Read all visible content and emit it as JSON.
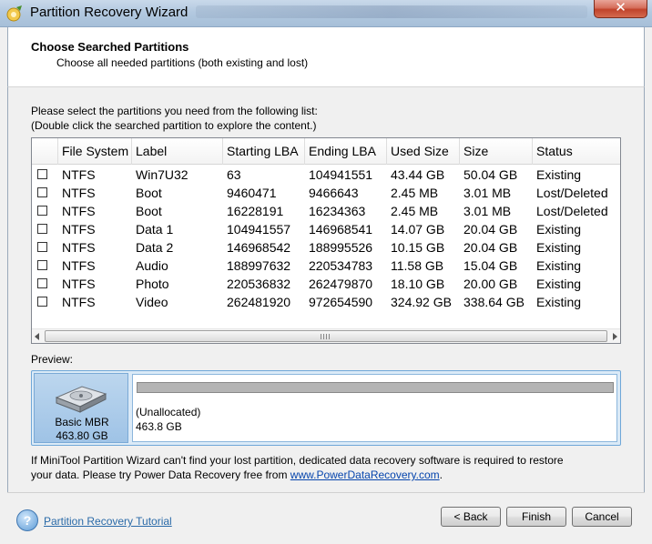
{
  "window": {
    "title": "Partition Recovery Wizard",
    "close": "✕"
  },
  "header": {
    "title": "Choose Searched Partitions",
    "subtitle": "Choose all needed partitions (both existing and lost)"
  },
  "instructions": {
    "line1": "Please select the partitions you need from the following list:",
    "line2": "(Double click the searched partition to explore the content.)"
  },
  "table": {
    "columns": [
      "",
      "File System",
      "Label",
      "Starting LBA",
      "Ending LBA",
      "Used Size",
      "Size",
      "Status"
    ],
    "rows": [
      {
        "fs": "NTFS",
        "label": "Win7U32",
        "start": "63",
        "end": "104941551",
        "used": "43.44 GB",
        "size": "50.04 GB",
        "status": "Existing"
      },
      {
        "fs": "NTFS",
        "label": "Boot",
        "start": "9460471",
        "end": "9466643",
        "used": "2.45 MB",
        "size": "3.01 MB",
        "status": "Lost/Deleted"
      },
      {
        "fs": "NTFS",
        "label": "Boot",
        "start": "16228191",
        "end": "16234363",
        "used": "2.45 MB",
        "size": "3.01 MB",
        "status": "Lost/Deleted"
      },
      {
        "fs": "NTFS",
        "label": "Data 1",
        "start": "104941557",
        "end": "146968541",
        "used": "14.07 GB",
        "size": "20.04 GB",
        "status": "Existing"
      },
      {
        "fs": "NTFS",
        "label": "Data 2",
        "start": "146968542",
        "end": "188995526",
        "used": "10.15 GB",
        "size": "20.04 GB",
        "status": "Existing"
      },
      {
        "fs": "NTFS",
        "label": "Audio",
        "start": "188997632",
        "end": "220534783",
        "used": "11.58 GB",
        "size": "15.04 GB",
        "status": "Existing"
      },
      {
        "fs": "NTFS",
        "label": "Photo",
        "start": "220536832",
        "end": "262479870",
        "used": "18.10 GB",
        "size": "20.00 GB",
        "status": "Existing"
      },
      {
        "fs": "NTFS",
        "label": "Video",
        "start": "262481920",
        "end": "972654590",
        "used": "324.92 GB",
        "size": "338.64 GB",
        "status": "Existing"
      }
    ]
  },
  "preview": {
    "label": "Preview:",
    "disk_type": "Basic MBR",
    "disk_size": "463.80 GB",
    "partition_name": "(Unallocated)",
    "partition_size": "463.8 GB"
  },
  "note": {
    "line1": "If MiniTool Partition Wizard can't find your lost partition, dedicated data recovery software is required to restore",
    "line2_prefix": "your data. Please try Power Data Recovery free from ",
    "link": "www.PowerDataRecovery.com",
    "line2_suffix": "."
  },
  "footer": {
    "tutorial": "Partition Recovery Tutorial",
    "help_glyph": "?",
    "back": "< Back",
    "finish": "Finish",
    "cancel": "Cancel"
  },
  "icons": [
    "wizard-icon",
    "close-icon",
    "hard-disk-icon",
    "help-icon"
  ]
}
